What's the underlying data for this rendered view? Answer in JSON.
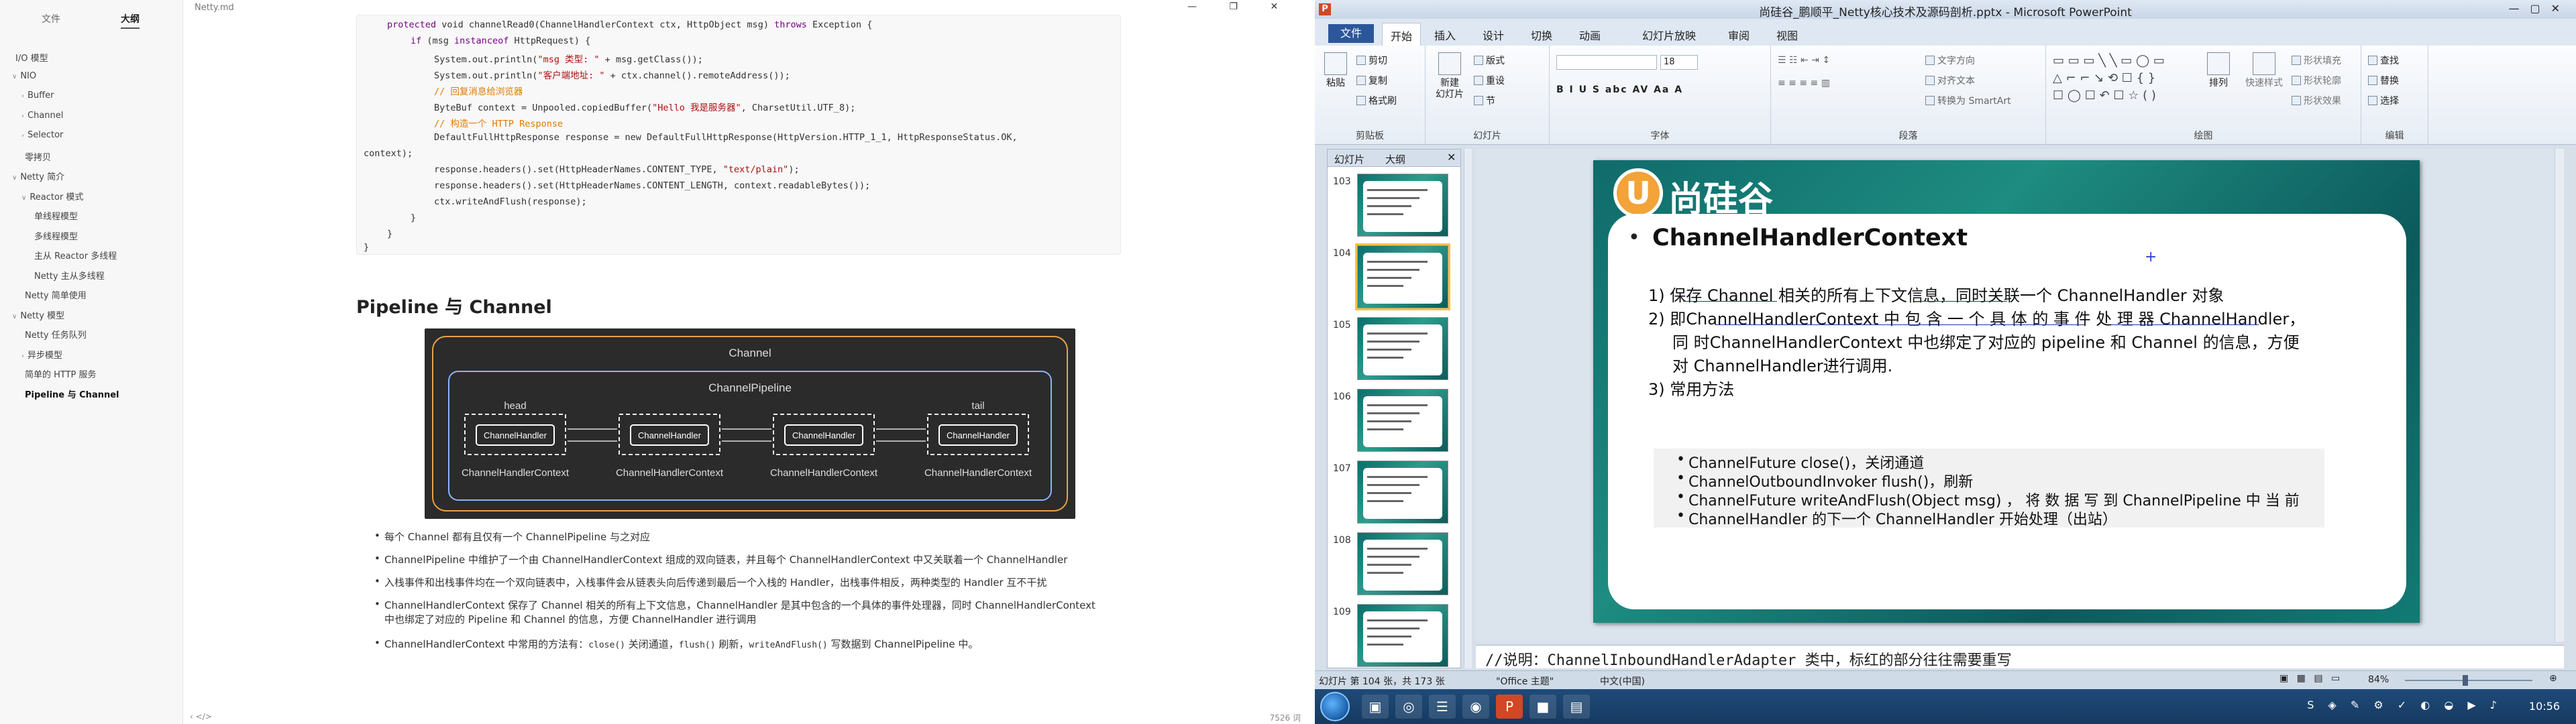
{
  "typora": {
    "tabs": {
      "files": "文件",
      "outline": "大纲"
    },
    "title": "Netty.md",
    "window_controls": "—  ❐  ✕",
    "outline": [
      {
        "label": "I/O 模型",
        "level": 0,
        "caret": ""
      },
      {
        "label": "NIO",
        "level": 0,
        "caret": "∨"
      },
      {
        "label": "Buffer",
        "level": 1,
        "caret": "›"
      },
      {
        "label": "Channel",
        "level": 1,
        "caret": "›"
      },
      {
        "label": "Selector",
        "level": 1,
        "caret": "›"
      },
      {
        "label": "零拷贝",
        "level": 1,
        "caret": ""
      },
      {
        "label": "Netty 简介",
        "level": 0,
        "caret": "∨"
      },
      {
        "label": "Reactor 模式",
        "level": 1,
        "caret": "∨"
      },
      {
        "label": "单线程模型",
        "level": 2,
        "caret": ""
      },
      {
        "label": "多线程模型",
        "level": 2,
        "caret": ""
      },
      {
        "label": "主从 Reactor 多线程",
        "level": 2,
        "caret": ""
      },
      {
        "label": "Netty 主从多线程",
        "level": 2,
        "caret": ""
      },
      {
        "label": "Netty 简单使用",
        "level": 1,
        "caret": ""
      },
      {
        "label": "Netty 模型",
        "level": 0,
        "caret": "∨"
      },
      {
        "label": "Netty 任务队列",
        "level": 1,
        "caret": ""
      },
      {
        "label": "异步模型",
        "level": 1,
        "caret": "›"
      },
      {
        "label": "简单的 HTTP 服务",
        "level": 1,
        "caret": ""
      },
      {
        "label": "Pipeline 与 Channel",
        "level": 1,
        "caret": "",
        "active": true
      }
    ],
    "code": {
      "l1a": "protected",
      "l1b": " void channelRead0(ChannelHandlerContext ctx, HttpObject msg) ",
      "l1c": "throws",
      "l1d": " Exception {",
      "l2a": "if",
      "l2b": " (msg ",
      "l2c": "instanceof",
      "l2d": " HttpRequest) {",
      "l3a": "System.out.println(",
      "l3b": "\"msg 类型: \"",
      "l3c": " + msg.getClass());",
      "l4a": "System.out.println(",
      "l4b": "\"客户端地址: \"",
      "l4c": " + ctx.channel().remoteAddress());",
      "l5": "// 回复消息给浏览器",
      "l6a": "ByteBuf context = Unpooled.copiedBuffer(",
      "l6b": "\"Hello 我是服务器\"",
      "l6c": ", CharsetUtil.UTF_8);",
      "l7": "// 构造一个 HTTP Response",
      "l8": "DefaultFullHttpResponse response = new DefaultFullHttpResponse(HttpVersion.HTTP_1_1, HttpResponseStatus.OK,",
      "l9": "context);",
      "l10a": "response.headers().set(HttpHeaderNames.CONTENT_TYPE, ",
      "l10b": "\"text/plain\"",
      "l10c": ");",
      "l11": "response.headers().set(HttpHeaderNames.CONTENT_LENGTH, context.readableBytes());",
      "l12": "ctx.writeAndFlush(response);",
      "l13": "}",
      "l14": "}",
      "l15": "}"
    },
    "heading": "Pipeline 与 Channel",
    "diagram": {
      "channel": "Channel",
      "pipeline": "ChannelPipeline",
      "head": "head",
      "tail": "tail",
      "handler": "ChannelHandler",
      "context": "ChannelHandlerContext"
    },
    "bullets": {
      "b1": "每个 Channel 都有且仅有一个 ChannelPipeline 与之对应",
      "b2": "ChannelPipeline 中维护了一个由 ChannelHandlerContext 组成的双向链表，并且每个 ChannelHandlerContext 中又关联着一个 ChannelHandler",
      "b3": "入栈事件和出栈事件均在一个双向链表中，入栈事件会从链表头向后传递到最后一个入栈的 Handler，出栈事件相反，两种类型的 Handler 互不干扰",
      "b4a": "ChannelHandlerContext 保存了 Channel 相关的所有上下文信息，ChannelHandler 是其中包含的一个具体的事件处理器，同时 ChannelHandlerContext",
      "b4b": "中也绑定了对应的 Pipeline 和 Channel 的信息，方便 ChannelHandler 进行调用",
      "b5a": "ChannelHandlerContext 中常用的方法有：",
      "b5b": "close()",
      "b5c": " 关闭通道，",
      "b5d": "flush()",
      "b5e": " 刷新，",
      "b5f": "writeAndFlush()",
      "b5g": " 写数据到 ChannelPipeline 中。"
    },
    "status_left": "‹  </>",
    "status_right": "7526 词"
  },
  "ppt": {
    "title": "尚硅谷_鹏顺平_Netty核心技术及源码剖析.pptx - Microsoft PowerPoint",
    "tabs": [
      "文件",
      "开始",
      "插入",
      "设计",
      "切换",
      "动画",
      "幻灯片放映",
      "审阅",
      "视图"
    ],
    "ribbon": {
      "clipboard": {
        "paste": "粘贴",
        "cut": "剪切",
        "copy": "复制",
        "format_painter": "格式刷",
        "label": "剪贴板"
      },
      "slides": {
        "new": "新建\n幻灯片",
        "layout": "版式",
        "reset": "重设",
        "section": "节",
        "label": "幻灯片"
      },
      "font": {
        "size": "18",
        "label": "字体",
        "buttons": "B  I  U  S  abc  AV  Aa  A"
      },
      "paragraph": {
        "text_dir": "文字方向",
        "align_text": "对齐文本",
        "smartart": "转换为 SmartArt",
        "label": "段落"
      },
      "drawing": {
        "arrange": "排列",
        "quick_styles": "快速样式",
        "fill": "形状填充",
        "outline": "形状轮廓",
        "effects": "形状效果",
        "label": "绘图"
      },
      "editing": {
        "find": "查找",
        "replace": "替换",
        "select": "选择",
        "label": "编辑"
      }
    },
    "pane_tabs": {
      "slides": "幻灯片",
      "outline": "大纲"
    },
    "thumbs": [
      "103",
      "104",
      "105",
      "106",
      "107",
      "108",
      "109"
    ],
    "slide": {
      "logo": "尚硅谷",
      "heading": "ChannelHandlerContext",
      "p1": "1)  保存 Channel 相关的所有上下文信息，同时关联一个 ChannelHandler 对象",
      "p2a": "2)  即ChannelHandlerContext 中 包 含 一 个 具 体 的 事 件 处 理 器 ChannelHandler，",
      "p2b": "同 时ChannelHandlerContext 中也绑定了对应的 pipeline 和 Channel 的信息，方便",
      "p2c": "对 ChannelHandler进行调用.",
      "p3": "3)  常用方法",
      "m1": "ChannelFuture close()，关闭通道",
      "m2": "ChannelOutboundInvoker flush()，刷新",
      "m3": "ChannelFuture writeAndFlush(Object msg) ， 将 数 据 写 到 ChannelPipeline  中 当 前",
      "m4": "ChannelHandler 的下一个 ChannelHandler 开始处理（出站）"
    },
    "notes": "//说明：ChannelInboundHandlerAdapter 类中，标红的部分往往需要重写",
    "status": {
      "slide": "幻灯片 第 104 张，共 173 张",
      "theme": "\"Office 主题\"",
      "lang": "中文(中国)",
      "zoom": "84%"
    },
    "clock": "10:56"
  },
  "colors": {
    "code_keyword": "#770088",
    "code_string": "#aa1111",
    "code_comment": "#e07a00",
    "ppt_file_tab": "#2b579a",
    "slide_teal": "#1e8c80"
  }
}
